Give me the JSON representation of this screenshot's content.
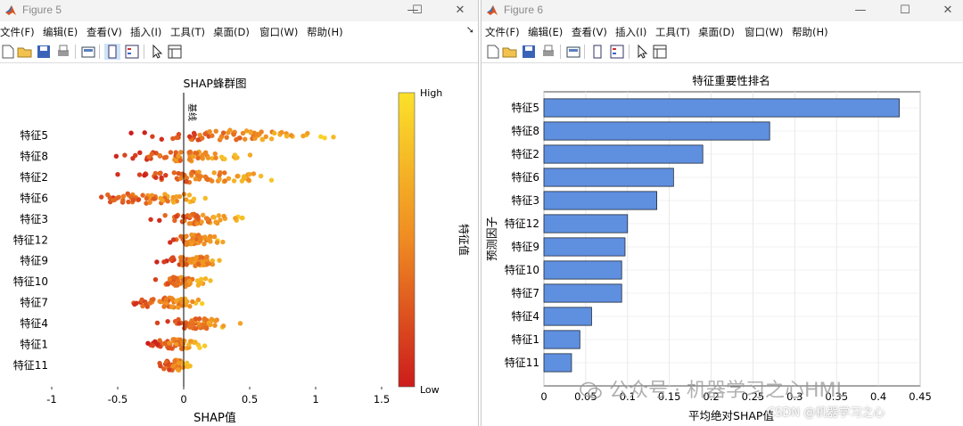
{
  "figure5": {
    "title": "Figure 5",
    "menu": [
      "文件(F)",
      "编辑(E)",
      "查看(V)",
      "插入(I)",
      "工具(T)",
      "桌面(D)",
      "窗口(W)",
      "帮助(H)"
    ],
    "dock_glyph": "➘",
    "window_buttons": {
      "minimize": "—",
      "maximize": "☐",
      "close": "✕"
    },
    "icons": [
      "new-icon",
      "open-icon",
      "save-icon",
      "print-icon",
      "print-preview-icon",
      "toggle-plot-tools-icon",
      "insert-legend-icon",
      "pointer-icon",
      "property-editor-icon"
    ]
  },
  "figure6": {
    "title": "Figure 6",
    "menu": [
      "文件(F)",
      "编辑(E)",
      "查看(V)",
      "插入(I)",
      "工具(T)",
      "桌面(D)",
      "窗口(W)",
      "帮助(H)"
    ],
    "dock_glyph": "➘",
    "window_buttons": {
      "minimize": "—",
      "maximize": "☐",
      "close": "✕"
    },
    "icons": [
      "new-icon",
      "open-icon",
      "save-icon",
      "print-icon",
      "print-preview-icon",
      "toggle-plot-tools-icon",
      "insert-legend-icon",
      "pointer-icon",
      "property-editor-icon"
    ]
  },
  "colors": {
    "bar_fill": "#5f8fdf",
    "bar_stroke": "#1f2a3a",
    "colormap_low": "#cc1c1c",
    "colormap_mid": "#ef8b22",
    "colormap_high": "#fbe12a",
    "baseline": "#000000"
  },
  "watermark": {
    "main": "公众号 · 机器学习之心HML",
    "csdn": "CSDN @机器学习之心"
  },
  "chart_data": [
    {
      "type": "scatter",
      "title": "SHAP蜂群图",
      "xlabel": "SHAP值",
      "ylabel": "",
      "xlim": [
        -1,
        1.5
      ],
      "xticks": [
        -1,
        -0.5,
        0,
        0.5,
        1,
        1.5
      ],
      "xtick_labels": [
        "-1",
        "-0.5",
        "0",
        "0.5",
        "1",
        "1.5"
      ],
      "grid": false,
      "baseline_label": "基线",
      "colorbar": {
        "label": "特征值",
        "high_label": "High",
        "low_label": "Low"
      },
      "categories": [
        "特征5",
        "特征8",
        "特征2",
        "特征6",
        "特征3",
        "特征12",
        "特征9",
        "特征10",
        "特征7",
        "特征4",
        "特征1",
        "特征11"
      ],
      "ranges": [
        {
          "feature": "特征5",
          "min": -0.55,
          "max": 1.25
        },
        {
          "feature": "特征8",
          "min": -0.65,
          "max": 0.6
        },
        {
          "feature": "特征2",
          "min": -0.6,
          "max": 0.82
        },
        {
          "feature": "特征6",
          "min": -0.82,
          "max": 0.3
        },
        {
          "feature": "特征3",
          "min": -0.32,
          "max": 0.55
        },
        {
          "feature": "特征12",
          "min": -0.22,
          "max": 0.35
        },
        {
          "feature": "特征9",
          "min": -0.25,
          "max": 0.4
        },
        {
          "feature": "特征10",
          "min": -0.3,
          "max": 0.25
        },
        {
          "feature": "特征7",
          "min": -0.5,
          "max": 0.25
        },
        {
          "feature": "特征4",
          "min": -0.25,
          "max": 0.46
        },
        {
          "feature": "特征1",
          "min": -0.32,
          "max": 0.2
        },
        {
          "feature": "特征11",
          "min": -0.22,
          "max": 0.1
        }
      ]
    },
    {
      "type": "bar",
      "orientation": "horizontal",
      "title": "特征重要性排名",
      "xlabel": "平均绝对SHAP值",
      "ylabel": "预测因子",
      "xlim": [
        0,
        0.45
      ],
      "xticks": [
        0,
        0.05,
        0.1,
        0.15,
        0.2,
        0.25,
        0.3,
        0.35,
        0.4,
        0.45
      ],
      "xtick_labels": [
        "0",
        "0.05",
        "0.1",
        "0.15",
        "0.2",
        "0.25",
        "0.3",
        "0.35",
        "0.4",
        "0.45"
      ],
      "grid": true,
      "categories": [
        "特征5",
        "特征8",
        "特征2",
        "特征6",
        "特征3",
        "特征12",
        "特征9",
        "特征10",
        "特征7",
        "特征4",
        "特征1",
        "特征11"
      ],
      "values": [
        0.425,
        0.27,
        0.19,
        0.155,
        0.135,
        0.1,
        0.097,
        0.093,
        0.093,
        0.057,
        0.043,
        0.033
      ]
    }
  ]
}
